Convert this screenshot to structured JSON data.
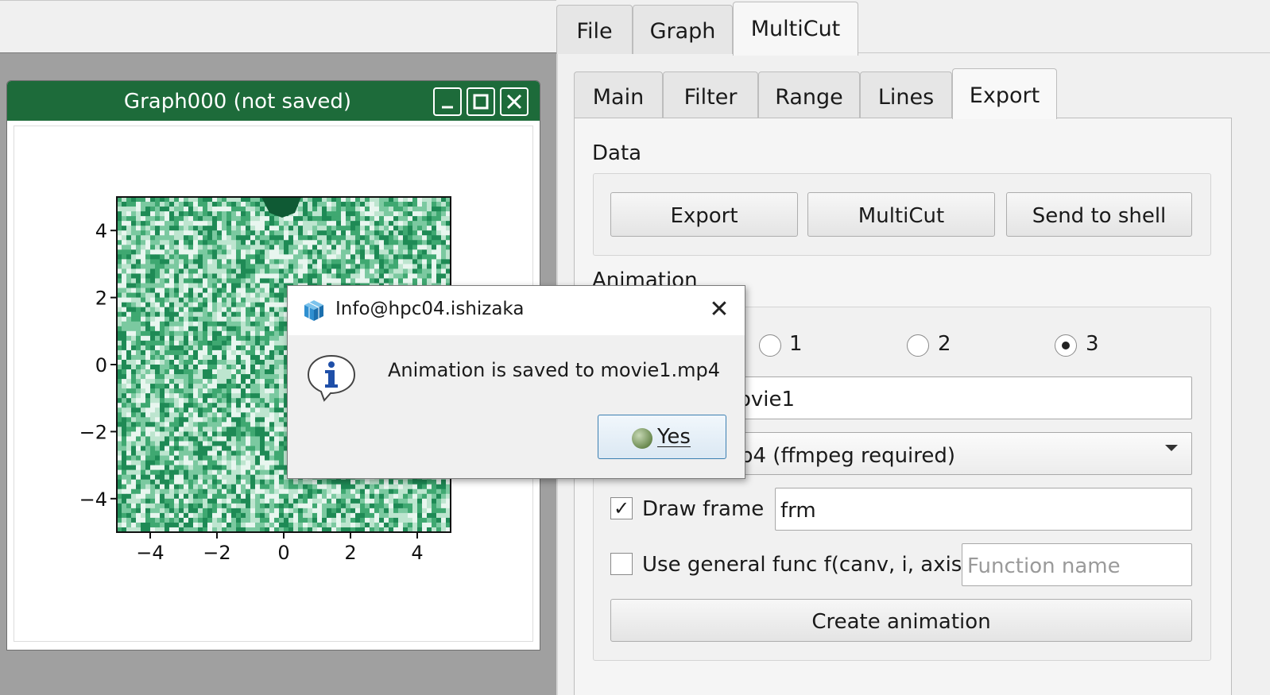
{
  "main_tabs": [
    {
      "label": "File"
    },
    {
      "label": "Graph"
    },
    {
      "label": "MultiCut"
    }
  ],
  "sub_tabs": [
    {
      "label": "Main"
    },
    {
      "label": "Filter"
    },
    {
      "label": "Range"
    },
    {
      "label": "Lines"
    },
    {
      "label": "Export"
    }
  ],
  "graph_window": {
    "title": "Graph000 (not saved)",
    "minimize_symbol": "_",
    "maximize_symbol": "□",
    "close_symbol": "✕"
  },
  "plot": {
    "x_ticks": [
      "−4",
      "−2",
      "0",
      "2",
      "4"
    ],
    "y_ticks": [
      "4",
      "2",
      "0",
      "−2",
      "−4"
    ],
    "xlim": [
      -5,
      5
    ],
    "ylim": [
      -5,
      5
    ],
    "colormap": [
      "#e8f6ef",
      "#bde5cf",
      "#7bc9a0",
      "#3fa871",
      "#1e8a55"
    ]
  },
  "export_panel": {
    "data_section": "Data",
    "buttons": {
      "export": "Export",
      "multicut": "MultiCut",
      "send_to_shell": "Send to shell"
    },
    "animation_section": "Animation",
    "axis_options": [
      {
        "label": "1",
        "selected": false
      },
      {
        "label": "2",
        "selected": false
      },
      {
        "label": "3",
        "selected": true
      }
    ],
    "filename_value": "ovie1",
    "format_value": "p4 (ffmpeg required)",
    "draw_frame": {
      "label": "Draw frame",
      "checked": true,
      "check_glyph": "✓",
      "value": "frm"
    },
    "general_func": {
      "label": "Use general func f(canv, i, axis)",
      "checked": false,
      "placeholder": "Function name"
    },
    "create_button": "Create animation"
  },
  "dialog": {
    "title": "Info@hpc04.ishizaka",
    "close_symbol": "✕",
    "message": "Animation is saved to movie1.mp4",
    "yes_label": "Yes",
    "info_icon": "info-icon"
  },
  "colors": {
    "titlebar_green": "#1d6b3a",
    "dialog_button_border": "#3c7fb1"
  }
}
